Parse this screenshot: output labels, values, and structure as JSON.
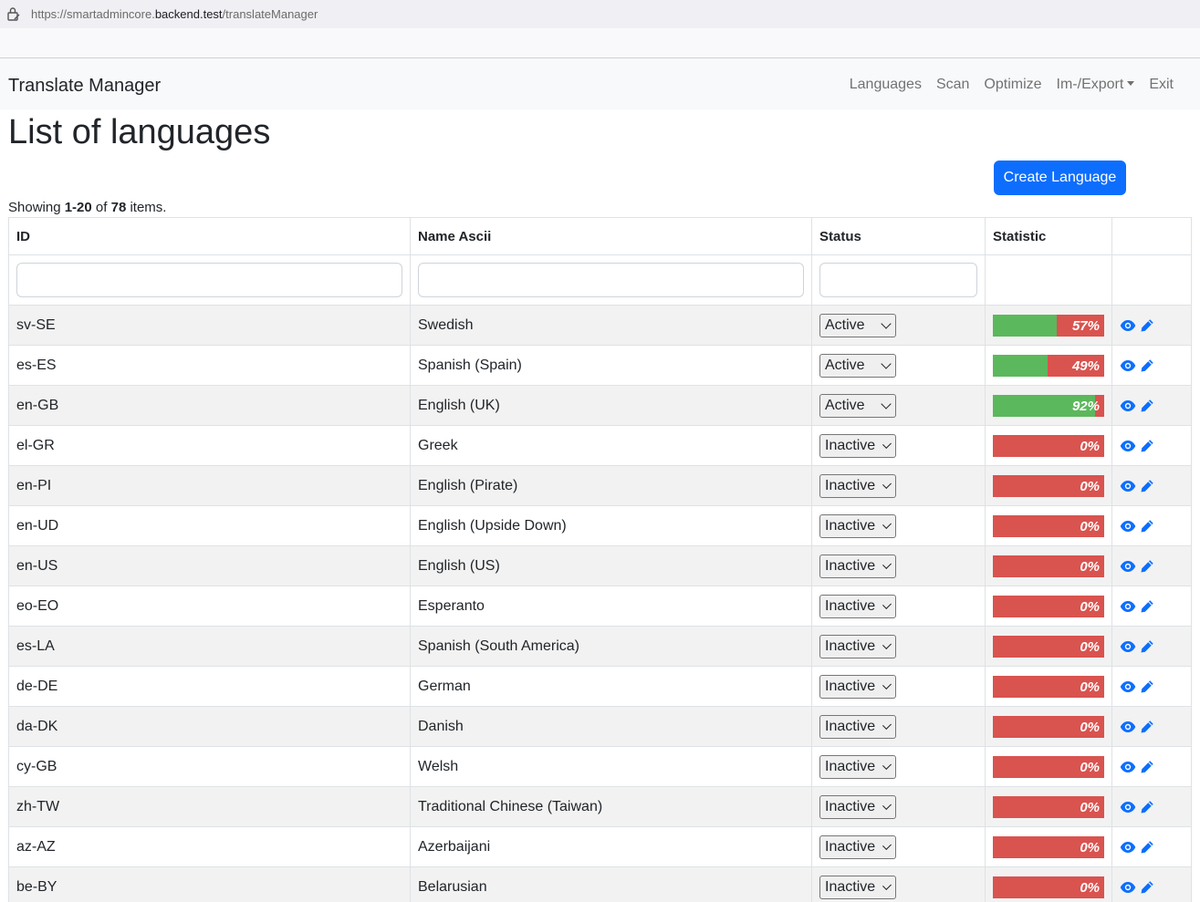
{
  "browser": {
    "url_prefix": "https://smartadmincore.",
    "url_host": "backend.test",
    "url_path": "/translateManager"
  },
  "navbar": {
    "brand": "Translate Manager",
    "links": [
      "Languages",
      "Scan",
      "Optimize",
      "Im-/Export",
      "Exit"
    ]
  },
  "page": {
    "title": "List of languages",
    "create_button": "Create Language",
    "summary_prefix": "Showing ",
    "summary_range": "1-20",
    "summary_mid": " of ",
    "summary_total": "78",
    "summary_suffix": " items."
  },
  "table": {
    "columns": [
      "ID",
      "Name Ascii",
      "Status",
      "Statistic",
      ""
    ],
    "rows": [
      {
        "id": "sv-SE",
        "name": "Swedish",
        "status": "Active",
        "stat": 57,
        "stat_label": "57%"
      },
      {
        "id": "es-ES",
        "name": "Spanish (Spain)",
        "status": "Active",
        "stat": 49,
        "stat_label": "49%"
      },
      {
        "id": "en-GB",
        "name": "English (UK)",
        "status": "Active",
        "stat": 92,
        "stat_label": "92%"
      },
      {
        "id": "el-GR",
        "name": "Greek",
        "status": "Inactive",
        "stat": 0,
        "stat_label": "0%"
      },
      {
        "id": "en-PI",
        "name": "English (Pirate)",
        "status": "Inactive",
        "stat": 0,
        "stat_label": "0%"
      },
      {
        "id": "en-UD",
        "name": "English (Upside Down)",
        "status": "Inactive",
        "stat": 0,
        "stat_label": "0%"
      },
      {
        "id": "en-US",
        "name": "English (US)",
        "status": "Inactive",
        "stat": 0,
        "stat_label": "0%"
      },
      {
        "id": "eo-EO",
        "name": "Esperanto",
        "status": "Inactive",
        "stat": 0,
        "stat_label": "0%"
      },
      {
        "id": "es-LA",
        "name": "Spanish (South America)",
        "status": "Inactive",
        "stat": 0,
        "stat_label": "0%"
      },
      {
        "id": "de-DE",
        "name": "German",
        "status": "Inactive",
        "stat": 0,
        "stat_label": "0%"
      },
      {
        "id": "da-DK",
        "name": "Danish",
        "status": "Inactive",
        "stat": 0,
        "stat_label": "0%"
      },
      {
        "id": "cy-GB",
        "name": "Welsh",
        "status": "Inactive",
        "stat": 0,
        "stat_label": "0%"
      },
      {
        "id": "zh-TW",
        "name": "Traditional Chinese (Taiwan)",
        "status": "Inactive",
        "stat": 0,
        "stat_label": "0%"
      },
      {
        "id": "az-AZ",
        "name": "Azerbaijani",
        "status": "Inactive",
        "stat": 0,
        "stat_label": "0%"
      },
      {
        "id": "be-BY",
        "name": "Belarusian",
        "status": "Inactive",
        "stat": 0,
        "stat_label": "0%"
      }
    ]
  },
  "colors": {
    "primary": "#0d6efd",
    "progress_done": "#5cb85c",
    "progress_missing": "#d9534f",
    "stripe": "#f2f2f2"
  },
  "icons": {
    "view": "eye-icon",
    "edit": "pencil-icon",
    "lock": "lock-icon"
  }
}
